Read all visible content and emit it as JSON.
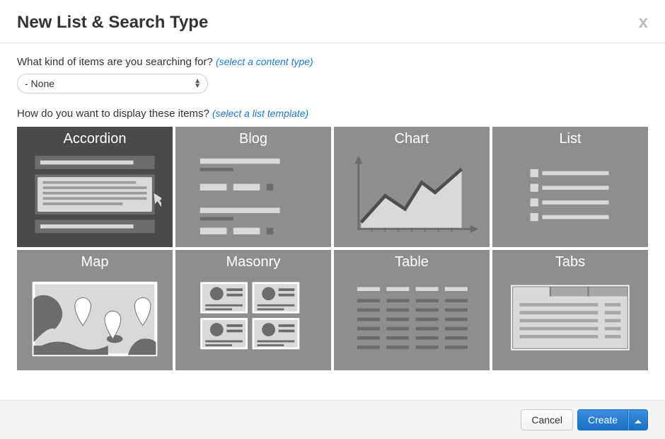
{
  "header": {
    "title": "New List & Search Type",
    "close_label": "x"
  },
  "content_type": {
    "prompt": "What kind of items are you searching for?",
    "hint": "(select a content type)",
    "selected": "- None"
  },
  "template": {
    "prompt": "How do you want to display these items?",
    "hint": "(select a list template)",
    "selected": "Accordion",
    "options": [
      {
        "key": "accordion",
        "label": "Accordion"
      },
      {
        "key": "blog",
        "label": "Blog"
      },
      {
        "key": "chart",
        "label": "Chart"
      },
      {
        "key": "list",
        "label": "List"
      },
      {
        "key": "map",
        "label": "Map"
      },
      {
        "key": "masonry",
        "label": "Masonry"
      },
      {
        "key": "table",
        "label": "Table"
      },
      {
        "key": "tabs",
        "label": "Tabs"
      }
    ]
  },
  "footer": {
    "cancel": "Cancel",
    "create": "Create"
  },
  "colors": {
    "tile": "#8e8e8e",
    "tile_selected": "#4a4a4a",
    "link": "#1a77d4",
    "primary": "#1a6fc4"
  }
}
